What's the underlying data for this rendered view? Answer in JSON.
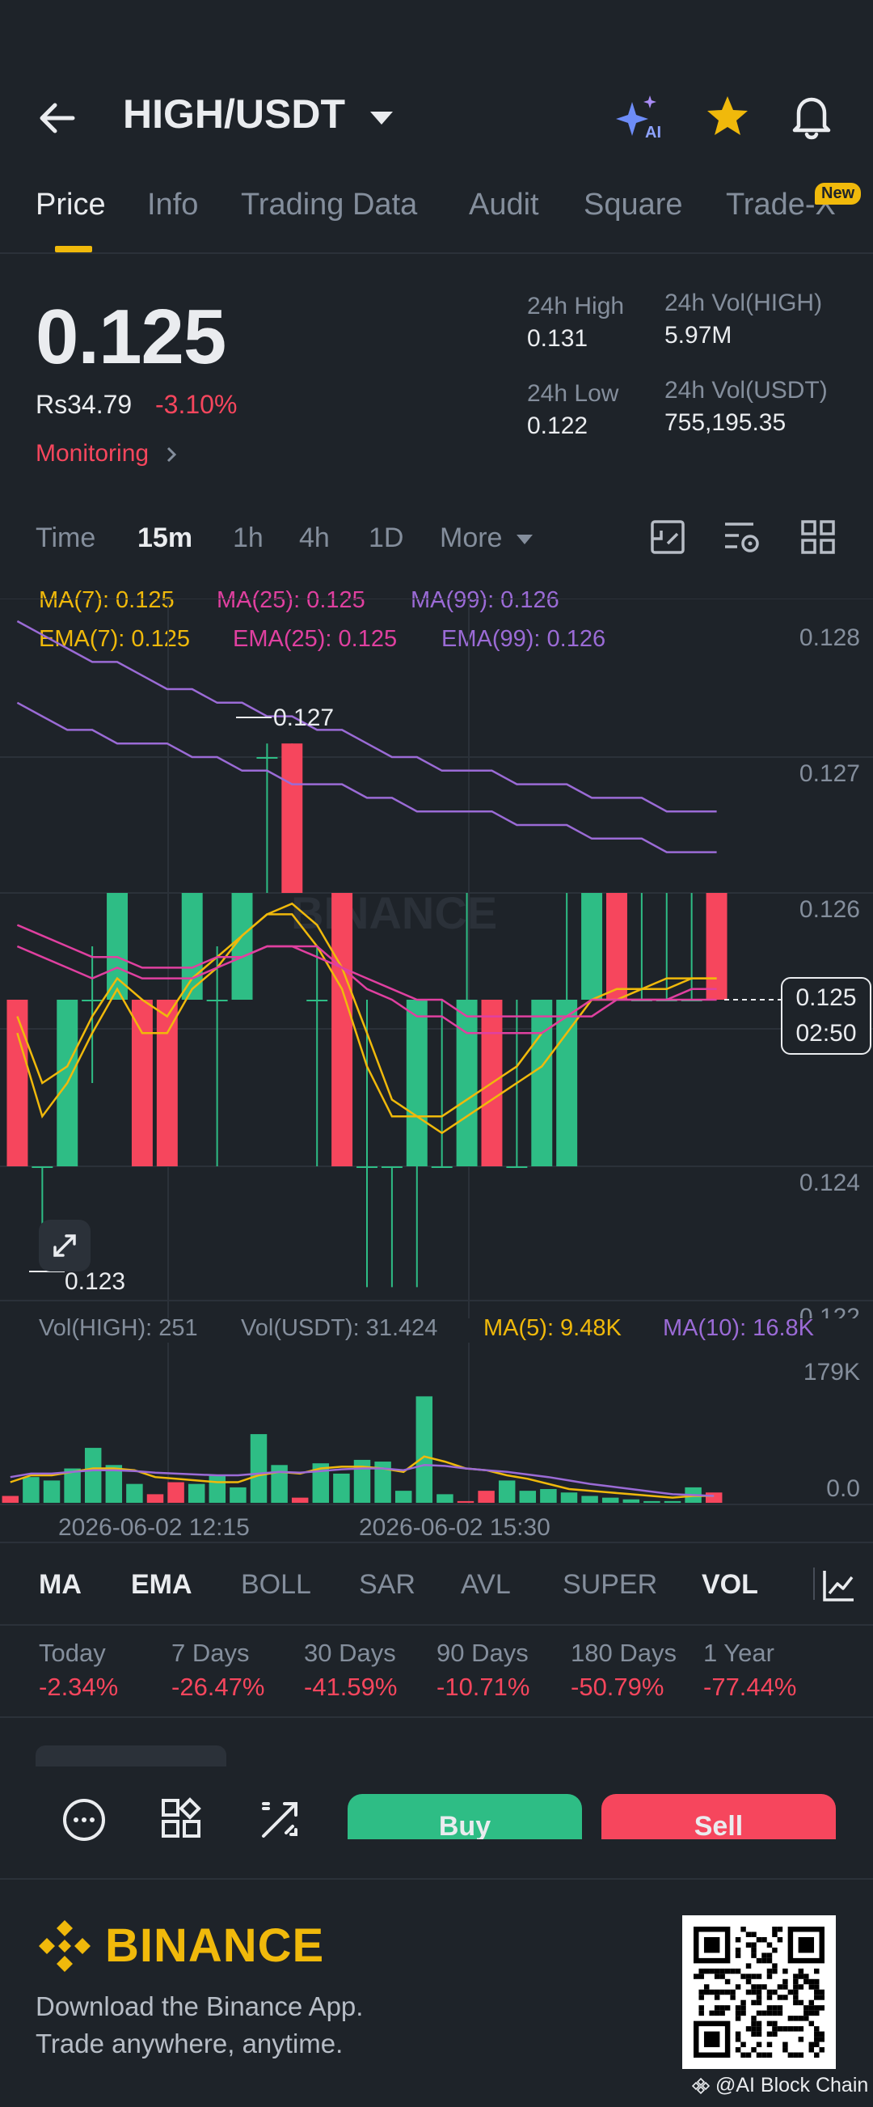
{
  "header": {
    "pair": "HIGH/USDT",
    "tabs": [
      "Price",
      "Info",
      "Trading Data",
      "Audit",
      "Square",
      "Trade-X"
    ],
    "new_badge": "New"
  },
  "price": {
    "last": "0.125",
    "fiat": "Rs34.79",
    "change": "-3.10%",
    "monitoring": "Monitoring",
    "high_label": "24h High",
    "high": "0.131",
    "low_label": "24h Low",
    "low": "0.122",
    "vol_base_label": "24h Vol(HIGH)",
    "vol_base": "5.97M",
    "vol_quote_label": "24h Vol(USDT)",
    "vol_quote": "755,195.35"
  },
  "intervals": [
    "Time",
    "15m",
    "1h",
    "4h",
    "1D",
    "More"
  ],
  "legend": {
    "ma7": "MA(7): 0.125",
    "ma25": "MA(25): 0.125",
    "ma99": "MA(99): 0.126",
    "ema7": "EMA(7): 0.125",
    "ema25": "EMA(25): 0.125",
    "ema99": "EMA(99): 0.126"
  },
  "chart_labels": {
    "high_marker": "0.127",
    "low_marker": "0.123",
    "watermark": "BINANCE",
    "tag_price": "0.125",
    "tag_time": "02:50",
    "vol_high": "Vol(HIGH): 251",
    "vol_usdt": "Vol(USDT): 31.424",
    "vol_ma5": "MA(5): 9.48K",
    "vol_ma10": "MA(10): 16.8K"
  },
  "indicators": [
    "MA",
    "EMA",
    "BOLL",
    "SAR",
    "AVL",
    "SUPER",
    "VOL"
  ],
  "performance": [
    {
      "label": "Today",
      "value": "-2.34%"
    },
    {
      "label": "7 Days",
      "value": "-26.47%"
    },
    {
      "label": "30 Days",
      "value": "-41.59%"
    },
    {
      "label": "90 Days",
      "value": "-10.71%"
    },
    {
      "label": "180 Days",
      "value": "-50.79%"
    },
    {
      "label": "1 Year",
      "value": "-77.44%"
    }
  ],
  "actions": {
    "buy": "Buy",
    "sell": "Sell"
  },
  "footer": {
    "brand": "BINANCE",
    "line1": "Download the Binance App.",
    "line2": "Trade anywhere, anytime.",
    "credit": "@AI Block Chain"
  },
  "colors": {
    "bg": "#1e2329",
    "up": "#2ebd85",
    "down": "#f6465d",
    "accent": "#f0b90b",
    "ma25": "#e040a0",
    "ma99": "#9b6bd6"
  },
  "chart_data": [
    {
      "type": "candlestick",
      "yticks": [
        "0.128",
        "0.127",
        "0.126",
        "0.125",
        "0.124",
        "0.122"
      ],
      "xticks": [
        "2026-06-02 12:15",
        "2026-06-02 15:30"
      ],
      "ylim": [
        0.122,
        0.128
      ],
      "candles": [
        [
          0.125,
          0.124,
          0.125,
          0.124
        ],
        [
          0.124,
          0.124,
          0.124,
          0.1225
        ],
        [
          0.124,
          0.125,
          0.125,
          0.124
        ],
        [
          0.125,
          0.125,
          0.1255,
          0.1245
        ],
        [
          0.125,
          0.126,
          0.126,
          0.125
        ],
        [
          0.125,
          0.124,
          0.125,
          0.124
        ],
        [
          0.125,
          0.124,
          0.125,
          0.124
        ],
        [
          0.125,
          0.126,
          0.126,
          0.125
        ],
        [
          0.125,
          0.125,
          0.1255,
          0.124
        ],
        [
          0.125,
          0.126,
          0.126,
          0.125
        ],
        [
          0.127,
          0.127,
          0.1271,
          0.126
        ],
        [
          0.1271,
          0.126,
          0.1271,
          0.126
        ],
        [
          0.125,
          0.125,
          0.1255,
          0.124
        ],
        [
          0.126,
          0.124,
          0.126,
          0.124
        ],
        [
          0.124,
          0.124,
          0.125,
          0.1222
        ],
        [
          0.124,
          0.124,
          0.124,
          0.1222
        ],
        [
          0.124,
          0.125,
          0.125,
          0.1222
        ],
        [
          0.124,
          0.124,
          0.125,
          0.124
        ],
        [
          0.124,
          0.125,
          0.126,
          0.124
        ],
        [
          0.125,
          0.124,
          0.125,
          0.124
        ],
        [
          0.124,
          0.124,
          0.125,
          0.124
        ],
        [
          0.124,
          0.125,
          0.125,
          0.124
        ],
        [
          0.124,
          0.125,
          0.126,
          0.124
        ],
        [
          0.125,
          0.126,
          0.126,
          0.125
        ],
        [
          0.126,
          0.125,
          0.126,
          0.125
        ],
        [
          0.125,
          0.125,
          0.126,
          0.125
        ],
        [
          0.125,
          0.125,
          0.126,
          0.125
        ],
        [
          0.125,
          0.125,
          0.126,
          0.125
        ],
        [
          0.126,
          0.125,
          0.126,
          0.125
        ]
      ],
      "series": [
        {
          "name": "MA(7)",
          "values": [
            0.1248,
            0.1243,
            0.1245,
            0.1248,
            0.1251,
            0.1248,
            0.1248,
            0.1251,
            0.1253,
            0.1256,
            0.1258,
            0.1259,
            0.1257,
            0.1253,
            0.1248,
            0.1244,
            0.1243,
            0.1242,
            0.1243,
            0.1244,
            0.1245,
            0.1246,
            0.1248,
            0.125,
            0.125,
            0.1251,
            0.1251,
            0.1252,
            0.1252
          ]
        },
        {
          "name": "EMA(7)",
          "values": [
            0.1249,
            0.1245,
            0.1246,
            0.1249,
            0.1252,
            0.125,
            0.1249,
            0.1252,
            0.1254,
            0.1256,
            0.1258,
            0.1258,
            0.1255,
            0.1251,
            0.1246,
            0.1243,
            0.1243,
            0.1243,
            0.1244,
            0.1245,
            0.1246,
            0.1248,
            0.1249,
            0.125,
            0.1251,
            0.1251,
            0.1252,
            0.1252,
            0.1252
          ]
        },
        {
          "name": "MA(25)",
          "values": [
            0.1255,
            0.1254,
            0.1253,
            0.1252,
            0.1253,
            0.1252,
            0.1252,
            0.1252,
            0.1253,
            0.1254,
            0.1255,
            0.1255,
            0.1255,
            0.1253,
            0.1251,
            0.125,
            0.1249,
            0.1249,
            0.1248,
            0.1248,
            0.1248,
            0.1248,
            0.1249,
            0.1249,
            0.125,
            0.125,
            0.125,
            0.125,
            0.125
          ]
        },
        {
          "name": "EMA(25)",
          "values": [
            0.1257,
            0.1256,
            0.1255,
            0.1254,
            0.1254,
            0.1253,
            0.1253,
            0.1253,
            0.1254,
            0.1254,
            0.1255,
            0.1255,
            0.1254,
            0.1253,
            0.1252,
            0.1251,
            0.125,
            0.125,
            0.1249,
            0.1249,
            0.1249,
            0.1249,
            0.1249,
            0.125,
            0.125,
            0.125,
            0.125,
            0.1251,
            0.1251
          ]
        },
        {
          "name": "MA(99)",
          "values": [
            0.128,
            0.1279,
            0.1278,
            0.1277,
            0.1277,
            0.1276,
            0.1275,
            0.1275,
            0.1274,
            0.1274,
            0.1273,
            0.1273,
            0.1272,
            0.1272,
            0.1271,
            0.127,
            0.127,
            0.1269,
            0.1269,
            0.1269,
            0.1268,
            0.1268,
            0.1268,
            0.1267,
            0.1267,
            0.1267,
            0.1266,
            0.1266,
            0.1266
          ]
        },
        {
          "name": "EMA(99)",
          "values": [
            0.1274,
            0.1273,
            0.1272,
            0.1272,
            0.1271,
            0.1271,
            0.1271,
            0.127,
            0.127,
            0.1269,
            0.1269,
            0.1268,
            0.1268,
            0.1268,
            0.1267,
            0.1267,
            0.1266,
            0.1266,
            0.1266,
            0.1266,
            0.1265,
            0.1265,
            0.1265,
            0.1264,
            0.1264,
            0.1264,
            0.1263,
            0.1263,
            0.1263
          ]
        }
      ]
    },
    {
      "type": "bar",
      "yticks": [
        "179K",
        "0.0"
      ],
      "ylim": [
        0,
        179
      ],
      "values": [
        8,
        30,
        26,
        40,
        64,
        44,
        22,
        10,
        24,
        22,
        32,
        18,
        80,
        44,
        6,
        46,
        34,
        50,
        48,
        14,
        124,
        10,
        2,
        14,
        26,
        14,
        16,
        12,
        8,
        6,
        4,
        2,
        2,
        18,
        12
      ],
      "colors": [
        "down",
        "up",
        "up",
        "up",
        "up",
        "up",
        "up",
        "down",
        "down",
        "up",
        "up",
        "up",
        "up",
        "up",
        "down",
        "up",
        "up",
        "up",
        "up",
        "up",
        "up",
        "up",
        "down",
        "down",
        "up",
        "up",
        "up",
        "up",
        "up",
        "up",
        "up",
        "up",
        "up",
        "up",
        "down"
      ],
      "series": [
        {
          "name": "MA(5)",
          "values": [
            24,
            32,
            32,
            36,
            40,
            40,
            38,
            30,
            28,
            26,
            24,
            24,
            32,
            36,
            34,
            40,
            42,
            42,
            40,
            36,
            54,
            48,
            40,
            38,
            32,
            28,
            22,
            16,
            14,
            12,
            10,
            8,
            6,
            8,
            8
          ]
        },
        {
          "name": "MA(10)",
          "values": [
            30,
            34,
            34,
            36,
            38,
            38,
            37,
            35,
            34,
            33,
            32,
            32,
            34,
            36,
            35,
            37,
            39,
            40,
            40,
            38,
            44,
            43,
            40,
            38,
            36,
            33,
            30,
            26,
            22,
            19,
            16,
            13,
            10,
            9,
            8
          ]
        }
      ]
    }
  ]
}
